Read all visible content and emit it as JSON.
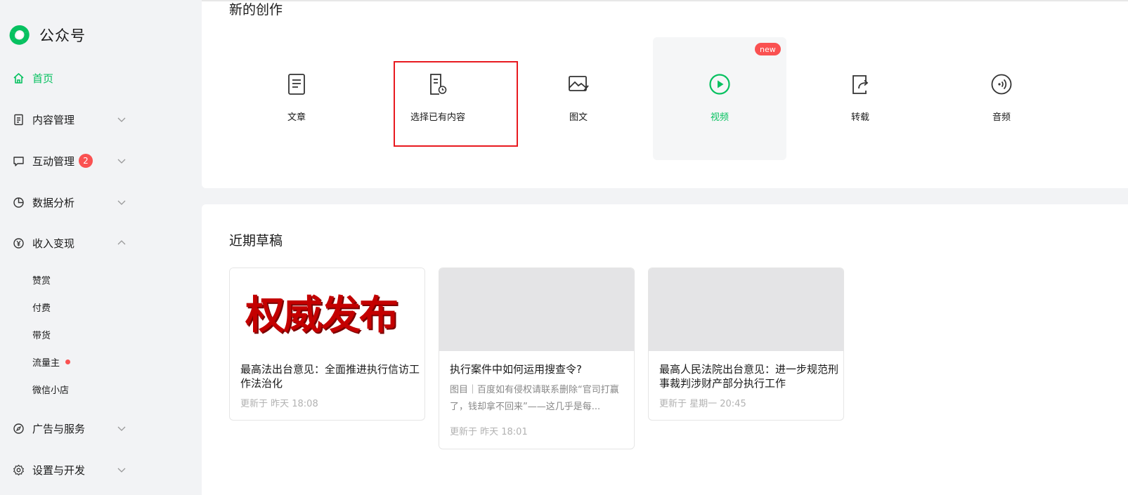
{
  "app": {
    "name": "公众号",
    "colors": {
      "accent": "#07c160",
      "badge": "#fa5151",
      "highlight_box": "#e8191f"
    }
  },
  "sidebar": {
    "items": [
      {
        "label": "首页",
        "icon": "home-icon",
        "active": true
      },
      {
        "label": "内容管理",
        "icon": "document-icon",
        "expanded": false
      },
      {
        "label": "互动管理",
        "icon": "chat-icon",
        "badge": "2",
        "expanded": false
      },
      {
        "label": "数据分析",
        "icon": "pie-chart-icon",
        "expanded": false
      },
      {
        "label": "收入变现",
        "icon": "yen-icon",
        "expanded": true
      },
      {
        "label": "广告与服务",
        "icon": "compass-icon",
        "expanded": false
      },
      {
        "label": "设置与开发",
        "icon": "gear-icon",
        "expanded": false
      }
    ],
    "income_sub": [
      "赞赏",
      "付费",
      "带货",
      "流量主",
      "微信小店"
    ]
  },
  "create": {
    "title": "新的创作",
    "items": [
      {
        "label": "文章",
        "icon": "article-icon"
      },
      {
        "label": "选择已有内容",
        "icon": "history-doc-icon"
      },
      {
        "label": "图文",
        "icon": "image-text-icon"
      },
      {
        "label": "视频",
        "icon": "play-icon",
        "badge": "new"
      },
      {
        "label": "转载",
        "icon": "repost-icon"
      },
      {
        "label": "音频",
        "icon": "audio-icon"
      }
    ]
  },
  "drafts": {
    "title": "近期草稿",
    "cards": [
      {
        "thumb_text": "权威发布",
        "title": "最高法出台意见：全面推进执行信访工作法治化",
        "meta": "更新于 昨天 18:08"
      },
      {
        "title": "执行案件中如何运用搜查令?",
        "desc": "图目｜百度如有侵权请联系删除“官司打赢了，钱却拿不回来”——这几乎是每...",
        "meta": "更新于 昨天 18:01"
      },
      {
        "title": "最高人民法院出台意见：进一步规范刑事裁判涉财产部分执行工作",
        "meta": "更新于 星期一 20:45"
      }
    ]
  }
}
